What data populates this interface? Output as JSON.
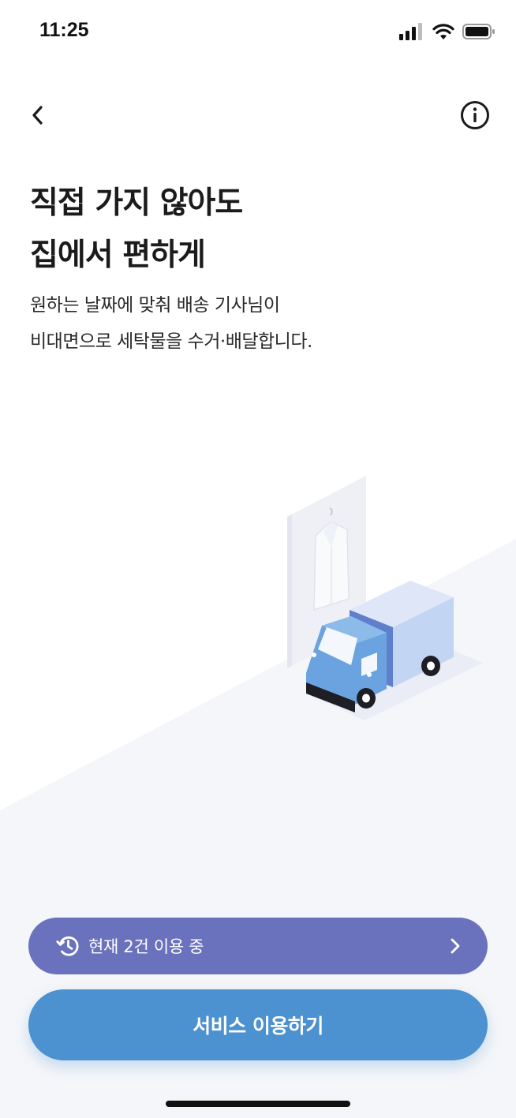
{
  "status_bar": {
    "time": "11:25"
  },
  "headline": {
    "line1": "직접 가지 않아도",
    "line2": "집에서 편하게"
  },
  "description": {
    "line1": "원하는 날짜에 맞춰 배송 기사님이",
    "line2": "비대면으로 세탁물을 수거·배달합니다."
  },
  "usage_banner": {
    "label": "현재 2건 이용 중",
    "color": "#6b72bd"
  },
  "primary_button": {
    "label": "서비스 이용하기",
    "color": "#4c91d0"
  },
  "icons": {
    "status": [
      "cellular-signal-icon",
      "wifi-icon",
      "battery-icon"
    ],
    "nav": [
      "back-arrow-icon",
      "info-icon"
    ],
    "banner": [
      "history-icon",
      "chevron-right-icon"
    ]
  },
  "illustration": {
    "subject": "delivery-truck-with-hanging-shirt"
  }
}
